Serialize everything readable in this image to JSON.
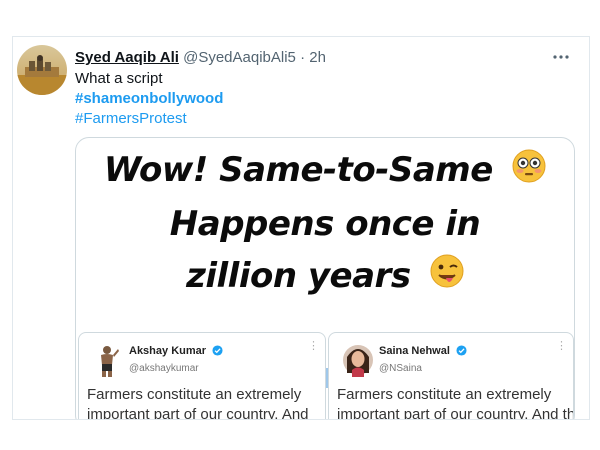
{
  "tweet": {
    "display_name": "Syed Aaqib Ali",
    "handle": "@SyedAaqibAli5",
    "separator": "·",
    "time": "2h",
    "text": "What a script",
    "hashtags": [
      "#shameonbollywood",
      "#FarmersProtest"
    ],
    "more_icon": "more-horizontal-icon"
  },
  "media": {
    "headline_lines": [
      "Wow! Same-to-Same",
      "Happens once in",
      "zillion years"
    ],
    "emoji_1": "flushed-face-emoji",
    "emoji_2": "winking-tongue-emoji",
    "embeds": [
      {
        "name": "Akshay Kumar",
        "handle": "@akshaykumar",
        "text": "Farmers constitute an extremely important part of our country. And the"
      },
      {
        "name": "Saina Nehwal",
        "handle": "@NSaina",
        "text": "Farmers constitute an extremely important part of our country. And th"
      }
    ]
  },
  "colors": {
    "link_blue": "#1d9bf0",
    "text_dark": "#0f1419",
    "text_gray": "#536471",
    "border": "#cfd9de"
  }
}
